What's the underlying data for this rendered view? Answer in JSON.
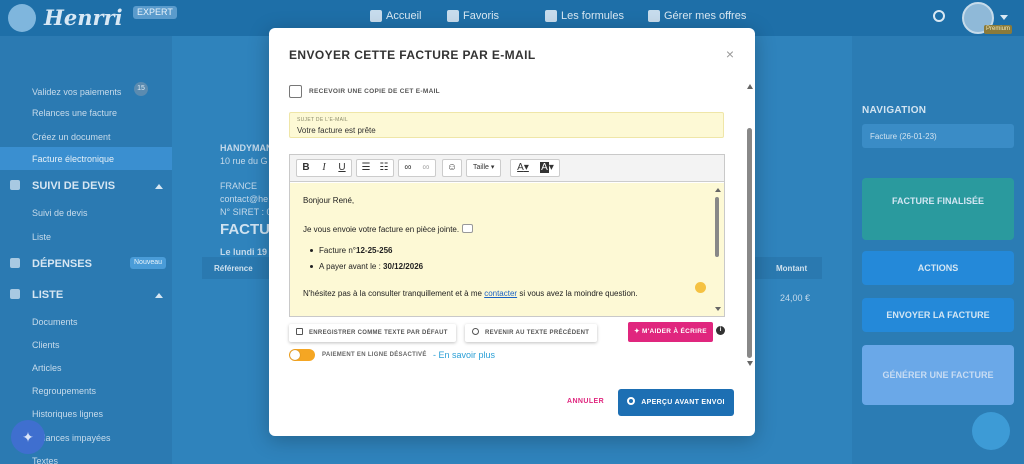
{
  "app": {
    "brand": "Henrri",
    "tier": "EXPERT",
    "avatar_badge": "Premium"
  },
  "topnav": {
    "home": "Accueil",
    "favorites": "Favoris",
    "plans": "Les formules",
    "offers": "Gérer mes offres"
  },
  "sidebar": {
    "items_top": [
      "Validez vos paiements",
      "Relances une facture",
      "Créez un document"
    ],
    "pending_count": "15",
    "active_item": "Facture électronique",
    "quotes_section": "SUIVI DE DEVIS",
    "quotes_items": [
      "Suivi de devis",
      "Liste"
    ],
    "expenses_section": "DÉPENSES",
    "expenses_badge": "Nouveau",
    "list_section": "LISTE",
    "list_items": [
      "Documents",
      "Clients",
      "Articles",
      "Regroupements",
      "Historiques lignes",
      "Relances impayées",
      "Textes"
    ]
  },
  "document": {
    "company": "HANDYMAN",
    "address": "10 rue du G",
    "country": "FRANCE",
    "contact": "contact@he",
    "siret": "N° SIRET : 0",
    "heading": "FACTUR",
    "date": "Le lundi 19",
    "col_reference": "Référence",
    "col_amount": "Montant",
    "amount_value": "24,00 €"
  },
  "right_panel": {
    "nav_title": "NAVIGATION",
    "nav_select": "Facture (26-01-23)",
    "finalized": "FACTURE FINALISÉE",
    "actions": "ACTIONS",
    "send": "ENVOYER LA FACTURE",
    "generate": "GÉNÉRER UNE FACTURE"
  },
  "modal": {
    "title": "ENVOYER CETTE FACTURE PAR E-MAIL",
    "copy_label": "RECEVOIR UNE COPIE DE CET E-MAIL",
    "subject_label": "SUJET DE L'E-MAIL",
    "subject_value": "Votre facture est prête",
    "toolbar": {
      "bold": "B",
      "italic": "I",
      "underline": "U",
      "size": "Taille",
      "font_color": "A",
      "bg_color": "A"
    },
    "body": {
      "greeting": "Bonjour René,",
      "intro": "Je vous envoie votre facture en pièce jointe.",
      "item1_prefix": "Facture n°",
      "item1_value": "12-25-256",
      "item2_prefix": "A payer avant le : ",
      "item2_value": "30/12/2026",
      "closing_before": "N'hésitez pas à la consulter tranquillement et à me ",
      "closing_link": "contacter",
      "closing_after": " si vous avez la moindre question."
    },
    "save_default": "ENREGISTRER COMME TEXTE PAR DÉFAUT",
    "revert": "REVENIR AU TEXTE PRÉCÉDENT",
    "ai_help": "M'AIDER À ÉCRIRE",
    "online_payment": "PAIEMENT EN LIGNE DÉSACTIVÉ",
    "learn_more": "- En savoir plus",
    "cancel": "ANNULER",
    "preview": "APERÇU AVANT ENVOI"
  },
  "colors": {
    "accent": "#1d6fb3",
    "pink": "#e0267e",
    "editor_bg": "#fdf9d5",
    "toggle": "#f5a623"
  }
}
